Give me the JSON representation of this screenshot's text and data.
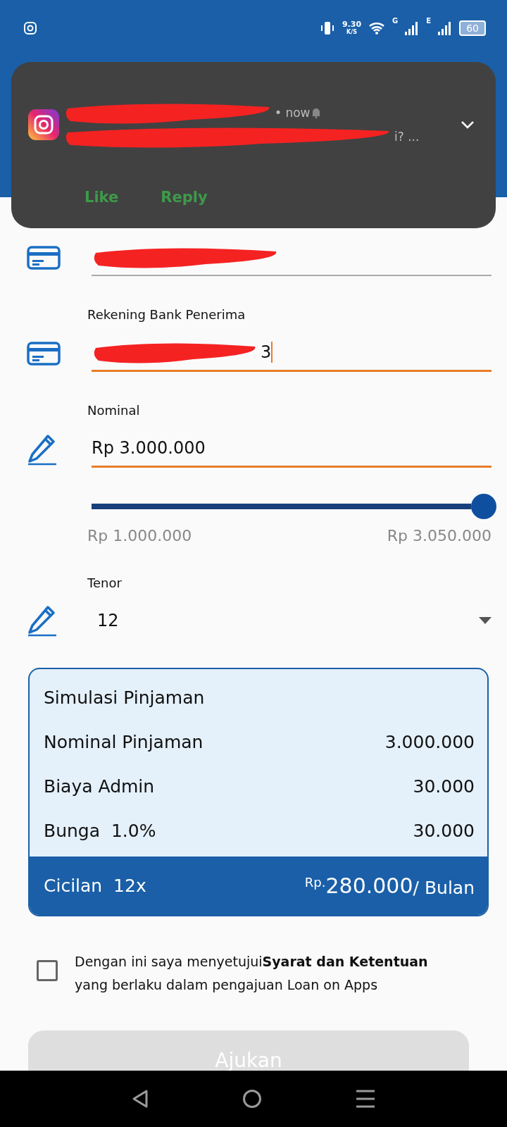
{
  "status_bar": {
    "speed": "9.30",
    "speed_unit": "K/S",
    "network_1": "G",
    "network_2": "E",
    "battery": "60"
  },
  "notification": {
    "time": "• now",
    "message_tail": "i? ...",
    "actions": [
      "Like",
      "Reply"
    ]
  },
  "fields": [
    {
      "kind": "text",
      "focused": false,
      "redacted": true
    },
    {
      "kind": "text",
      "label": "Rekening Bank Penerima",
      "value": "3",
      "focused": true,
      "redacted": true
    },
    {
      "kind": "amount",
      "label": "Nominal",
      "value": "Rp 3.000.000",
      "focused": true
    },
    {
      "kind": "select",
      "label": "Tenor",
      "value": "12",
      "focused": false
    }
  ],
  "slider": {
    "level": 0.98,
    "min_label": "Rp 1.000.000",
    "max_label": "Rp 3.050.000"
  },
  "simulation": {
    "title": "Simulasi Pinjaman",
    "rows": [
      {
        "label": "Nominal Pinjaman",
        "value": "3.000.000"
      },
      {
        "label": "Biaya Admin",
        "value": "30.000"
      },
      {
        "label": "Bunga  1.0%",
        "value": "30.000"
      }
    ],
    "installment_label": "Cicilan  12x",
    "currency": "Rp.",
    "amount": "280.000",
    "per": "/ Bulan"
  },
  "agreement": {
    "checked": false,
    "text": "Dengan ini saya menyetujui**Syarat dan Ketentuan** yang berlaku dalam pengajuan Loan on Apps"
  },
  "submit": {
    "label": "Ajukan",
    "disabled": true
  }
}
